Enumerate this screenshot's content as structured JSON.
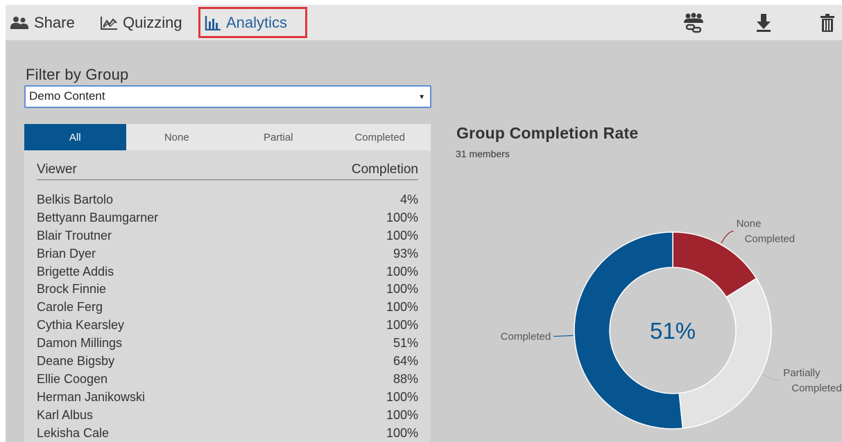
{
  "toolbar": {
    "share_label": "Share",
    "quizzing_label": "Quizzing",
    "analytics_label": "Analytics",
    "icons": [
      "share-people-icon",
      "quiz-chart-icon",
      "bar-chart-icon",
      "group-link-icon",
      "download-icon",
      "trash-icon"
    ]
  },
  "filter": {
    "title": "Filter by Group",
    "selected": "Demo Content"
  },
  "tabs": [
    "All",
    "None",
    "Partial",
    "Completed"
  ],
  "active_tab": "All",
  "table": {
    "headers": [
      "Viewer",
      "Completion"
    ],
    "rows": [
      {
        "name": "Belkis Bartolo",
        "completion": "4%"
      },
      {
        "name": "Bettyann Baumgarner",
        "completion": "100%"
      },
      {
        "name": "Blair Troutner",
        "completion": "100%"
      },
      {
        "name": "Brian Dyer",
        "completion": "93%"
      },
      {
        "name": "Brigette Addis",
        "completion": "100%"
      },
      {
        "name": "Brock Finnie",
        "completion": "100%"
      },
      {
        "name": "Carole Ferg",
        "completion": "100%"
      },
      {
        "name": "Cythia Kearsley",
        "completion": "100%"
      },
      {
        "name": "Damon Millings",
        "completion": "51%"
      },
      {
        "name": "Deane Bigsby",
        "completion": "64%"
      },
      {
        "name": "Ellie Coogen",
        "completion": "88%"
      },
      {
        "name": "Herman Janikowski",
        "completion": "100%"
      },
      {
        "name": "Karl Albus",
        "completion": "100%"
      },
      {
        "name": "Lekisha Cale",
        "completion": "100%"
      }
    ]
  },
  "chart_title": "Group Completion Rate",
  "members_text": "31 members",
  "colors": {
    "none": "#a0242e",
    "partial": "#e3e3e3",
    "completed": "#075590",
    "active_tab": "#075590",
    "highlight": "#e0363b"
  },
  "chart_data": {
    "type": "pie",
    "title": "Group Completion Rate",
    "subtitle": "31 members",
    "center_label": "51%",
    "categories": [
      "None Completed",
      "Partially Completed",
      "Completed"
    ],
    "label_lines": [
      [
        "None",
        "Completed"
      ],
      [
        "Partially",
        "Completed"
      ],
      [
        "Completed"
      ]
    ],
    "values": [
      5,
      10,
      16
    ]
  }
}
